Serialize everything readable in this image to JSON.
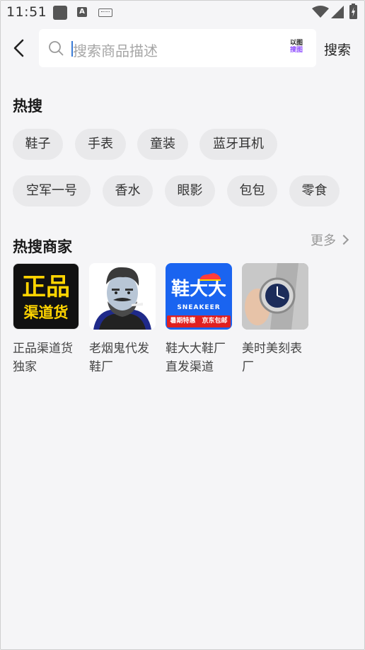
{
  "status_bar": {
    "time": "11:51",
    "a_icon_letter": "A"
  },
  "search": {
    "placeholder": "搜索商品描述",
    "image_search_line1": "以图",
    "image_search_line2": "搜图",
    "button_label": "搜索"
  },
  "hot_search": {
    "title": "热搜",
    "tags": [
      "鞋子",
      "手表",
      "童装",
      "蓝牙耳机",
      "空军一号",
      "香水",
      "眼影",
      "包包",
      "零食"
    ]
  },
  "hot_shops": {
    "title": "热搜商家",
    "more_label": "更多",
    "shops": [
      {
        "name": "正品渠道货独家",
        "logo_line1": "正品",
        "logo_line2": "渠道货"
      },
      {
        "name": "老烟鬼代发鞋厂"
      },
      {
        "name": "鞋大大鞋厂直发渠道",
        "logo_title": "鞋大大",
        "logo_sub": "SNEAKEER",
        "logo_left": "暑期特惠",
        "logo_right": "京东包邮"
      },
      {
        "name": "美时美刻表厂"
      }
    ]
  },
  "colors": {
    "accent": "#3a7bd5",
    "image_search": "#8e4bff",
    "shop1_bg": "#111111",
    "shop1_text": "#ffd400",
    "shop3_bg": "#1a64f0"
  }
}
